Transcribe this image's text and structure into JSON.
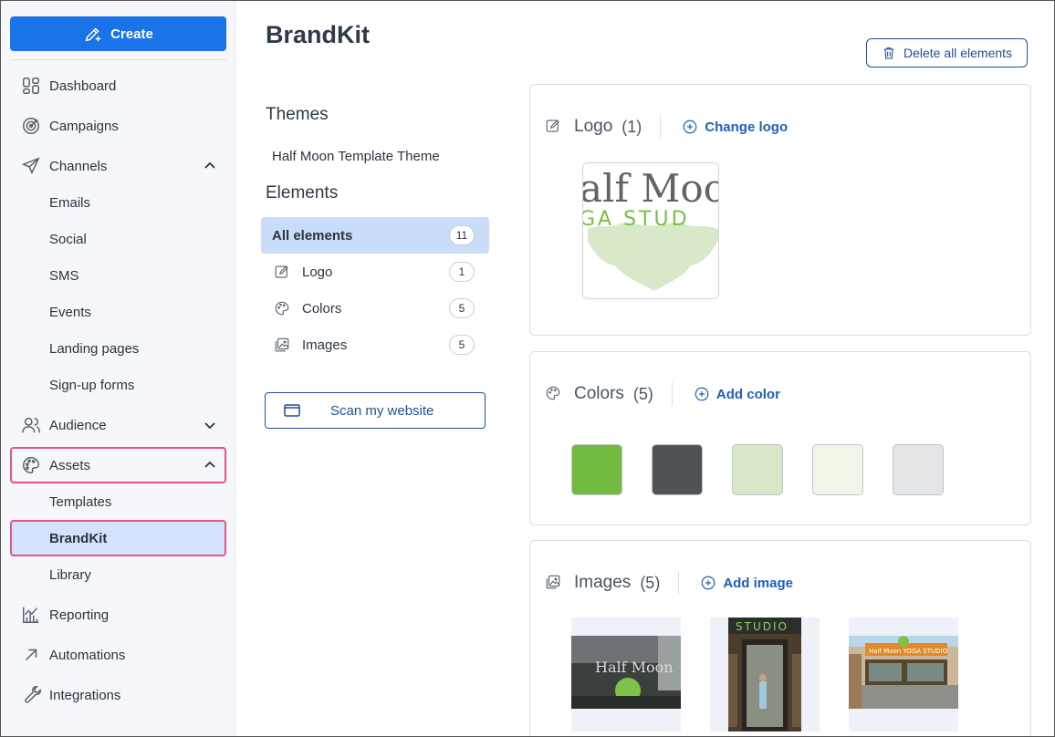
{
  "sidebar": {
    "create_label": "Create",
    "items": [
      {
        "label": "Dashboard",
        "icon": "dashboard-icon"
      },
      {
        "label": "Campaigns",
        "icon": "target-icon"
      },
      {
        "label": "Channels",
        "icon": "send-icon"
      },
      {
        "label": "Audience",
        "icon": "users-icon"
      },
      {
        "label": "Assets",
        "icon": "palette-icon"
      },
      {
        "label": "Reporting",
        "icon": "chart-icon"
      },
      {
        "label": "Automations",
        "icon": "arrow-icon"
      },
      {
        "label": "Integrations",
        "icon": "wrench-icon"
      }
    ],
    "channels_sub": [
      "Emails",
      "Social",
      "SMS",
      "Events",
      "Landing pages",
      "Sign-up forms"
    ],
    "assets_sub": [
      "Templates",
      "BrandKit",
      "Library"
    ]
  },
  "page": {
    "title": "BrandKit",
    "delete_label": "Delete all elements"
  },
  "themes": {
    "heading": "Themes",
    "item": "Half Moon Template Theme"
  },
  "elements": {
    "heading": "Elements",
    "items": [
      {
        "label": "All elements",
        "count": "11"
      },
      {
        "label": "Logo",
        "count": "1"
      },
      {
        "label": "Colors",
        "count": "5"
      },
      {
        "label": "Images",
        "count": "5"
      }
    ],
    "scan_label": "Scan my website"
  },
  "logo_card": {
    "title": "Logo",
    "count": "(1)",
    "action": "Change logo",
    "logo_line1": "alf Moo",
    "logo_line2": "GA STUD"
  },
  "colors_card": {
    "title": "Colors",
    "count": "(5)",
    "action": "Add color",
    "swatches": [
      "#72bb3f",
      "#4e5357",
      "#d8e8c8",
      "#eef6e8",
      "#e3e5e6"
    ]
  },
  "images_card": {
    "title": "Images",
    "count": "(5)",
    "action": "Add image",
    "img1_text": "Half Moon",
    "img2_text": "STUDIO",
    "img3_text": "Half Moon YOGA STUDIO"
  }
}
